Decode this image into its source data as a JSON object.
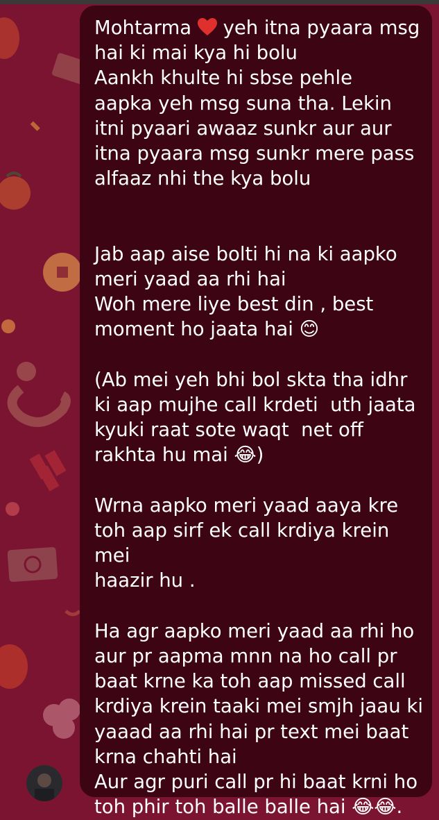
{
  "chat": {
    "message_lines": [
      "Mohtarma",
      " yeh itna pyaara msg",
      "hai ki mai kya hi bolu",
      "Aankh khulte hi sbse pehle",
      "aapka yeh msg suna tha. Lekin",
      "itni pyaari awaaz sunkr aur aur",
      "itna pyaara msg sunkr mere pass",
      "alfaaz nhi the kya bolu",
      "",
      "",
      "Jab aap aise bolti hi na ki aapko",
      "meri yaad aa rhi hai",
      "Woh mere liye best din , best",
      "moment ho jaata hai 😊",
      "",
      "(Ab mei yeh bhi bol skta tha idhr",
      "ki aap mujhe call krdeti  uth jaata",
      "kyuki raat sote waqt  net off",
      "rakhta hu mai 😂)",
      "",
      "Wrna aapko meri yaad aaya kre",
      "toh aap sirf ek call krdiya krein mei",
      "haazir hu .",
      "",
      "Ha agr aapko meri yaad aa rhi ho",
      "aur pr aapma mnn na ho call pr",
      "baat krne ka toh aap missed call",
      "krdiya krein taaki mei smjh jaau ki",
      "yaaad aa rhi hai pr text mei baat",
      "krna chahti hai",
      "Aur agr puri call pr hi baat krni ho",
      "toh phir toh balle balle hai 😂😂."
    ],
    "heart_icon": "red-heart-icon",
    "colors": {
      "background": "#7a1430",
      "bubble": "#3d0414",
      "text": "#ffffff"
    }
  }
}
